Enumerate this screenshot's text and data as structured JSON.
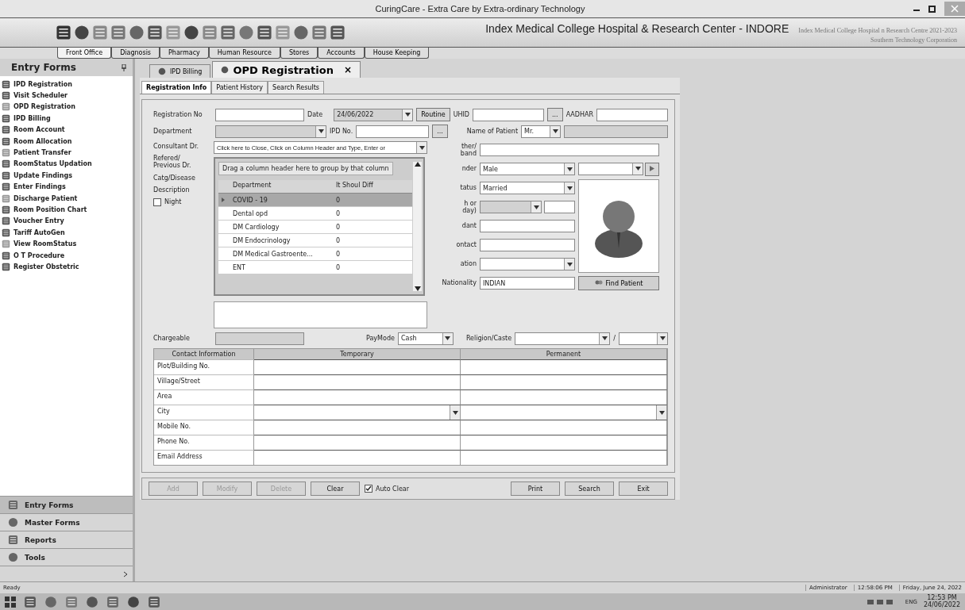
{
  "window": {
    "title": "CuringCare - Extra Care by Extra-ordinary Technology"
  },
  "banner": {
    "title": "Index Medical College Hospital & Research Center - INDORE",
    "subtitle": "Index Medical College Hospital n Research Centre 2021-2023",
    "vendor": "Southern Technology Corporation"
  },
  "modules": [
    {
      "label": "Front Office",
      "selected": true
    },
    {
      "label": "Diagnosis",
      "selected": false
    },
    {
      "label": "Pharmacy",
      "selected": false
    },
    {
      "label": "Human Resource",
      "selected": false
    },
    {
      "label": "Stores",
      "selected": false
    },
    {
      "label": "Accounts",
      "selected": false
    },
    {
      "label": "House Keeping",
      "selected": false
    }
  ],
  "sidebar": {
    "title": "Entry Forms",
    "items": [
      "IPD Registration",
      "Visit Scheduler",
      "OPD Registration",
      "IPD Billing",
      "Room Account",
      "Room Allocation",
      "Patient Transfer",
      "RoomStatus Updation",
      "Update Findings",
      "Enter Findings",
      "Discharge Patient",
      "Room Position Chart",
      "Voucher Entry",
      "Tariff AutoGen",
      "View RoomStatus",
      "O T Procedure",
      "Register Obstetric"
    ],
    "sections": [
      {
        "label": "Entry Forms",
        "selected": true
      },
      {
        "label": "Master Forms",
        "selected": false
      },
      {
        "label": "Reports",
        "selected": false
      },
      {
        "label": "Tools",
        "selected": false
      }
    ]
  },
  "doc_tabs": [
    {
      "label": "IPD Billing",
      "selected": false
    },
    {
      "label": "OPD Registration",
      "selected": true,
      "close": "×"
    }
  ],
  "sub_tabs": [
    {
      "label": "Registration Info",
      "selected": true
    },
    {
      "label": "Patient History",
      "selected": false
    },
    {
      "label": "Search Results",
      "selected": false
    }
  ],
  "form": {
    "registration_no": {
      "label": "Registration No"
    },
    "date": {
      "label": "Date",
      "value": "24/06/2022"
    },
    "routine": "Routine",
    "uhid": {
      "label": "UHID",
      "button": "..."
    },
    "aadhar": {
      "label": "AADHAR"
    },
    "department": {
      "label": "Department"
    },
    "ipd_no": {
      "label": "IPD No.",
      "button": "..."
    },
    "name_of_patient": {
      "label": "Name of Patient",
      "title": "Mr."
    },
    "left_labels": [
      "Consultant Dr.",
      "Refered/\nPrevious Dr.",
      "Catg/Disease",
      "Description"
    ],
    "consultant_value": "Click here to Close, Click on Column Header and Type, Enter or",
    "night": {
      "label": "Night",
      "checked": false
    },
    "side_fields": [
      {
        "label": "ther/\nband",
        "kind": "text"
      },
      {
        "label": "nder",
        "kind": "combo",
        "value": "Male"
      },
      {
        "label": "tatus",
        "kind": "combo",
        "value": "Married"
      },
      {
        "label": "h or\nday)",
        "kind": "combo-text"
      },
      {
        "label": "dant",
        "kind": "text"
      },
      {
        "label": "ontact",
        "kind": "text"
      },
      {
        "label": "ation",
        "kind": "combo"
      },
      {
        "label": "Nationality",
        "kind": "text",
        "value": "INDIAN"
      }
    ],
    "find_patient": "Find Patient",
    "chargeable": {
      "label": "Chargeable"
    },
    "pay_mode": {
      "label": "PayMode",
      "value": "Cash"
    },
    "religion": {
      "label": "Religion/Caste",
      "separator": "/"
    }
  },
  "dropdown": {
    "group_hint": "Drag a column header here to group by that column",
    "columns": [
      "Department",
      "It Shoul Diff"
    ],
    "rows": [
      {
        "department": "COVID - 19",
        "diff": "0",
        "selected": true
      },
      {
        "department": "Dental opd",
        "diff": "0",
        "selected": false
      },
      {
        "department": "DM Cardiology",
        "diff": "0",
        "selected": false
      },
      {
        "department": "DM Endocrinology",
        "diff": "0",
        "selected": false
      },
      {
        "department": "DM Medical Gastroente...",
        "diff": "0",
        "selected": false
      },
      {
        "department": "ENT",
        "diff": "0",
        "selected": false
      }
    ]
  },
  "contact": {
    "columns": [
      "Contact Information",
      "Temporary",
      "Permanent"
    ],
    "rows": [
      {
        "label": "Plot/Building No.",
        "kind": "text"
      },
      {
        "label": "Village/Street",
        "kind": "text"
      },
      {
        "label": "Area",
        "kind": "text"
      },
      {
        "label": "City",
        "kind": "combo"
      },
      {
        "label": "Mobile No.",
        "kind": "text"
      },
      {
        "label": "Phone No.",
        "kind": "text"
      },
      {
        "label": "Email Address",
        "kind": "text"
      }
    ]
  },
  "buttons": [
    {
      "label": "Add",
      "disabled": true
    },
    {
      "label": "Modify",
      "disabled": true
    },
    {
      "label": "Delete",
      "disabled": true
    },
    {
      "label": "Clear",
      "disabled": false
    }
  ],
  "auto_clear": {
    "label": "Auto Clear",
    "checked": true
  },
  "right_buttons": [
    {
      "label": "Print",
      "disabled": false
    },
    {
      "label": "Search",
      "disabled": false
    },
    {
      "label": "Exit",
      "disabled": false
    }
  ],
  "status_bar": {
    "text": "Ready",
    "user": "Administrator",
    "time": "12:58:06 PM",
    "date": "Friday, June 24, 2022"
  },
  "taskbar": {
    "language": "ENG",
    "time": "12:53 PM",
    "date": "24/06/2022"
  }
}
